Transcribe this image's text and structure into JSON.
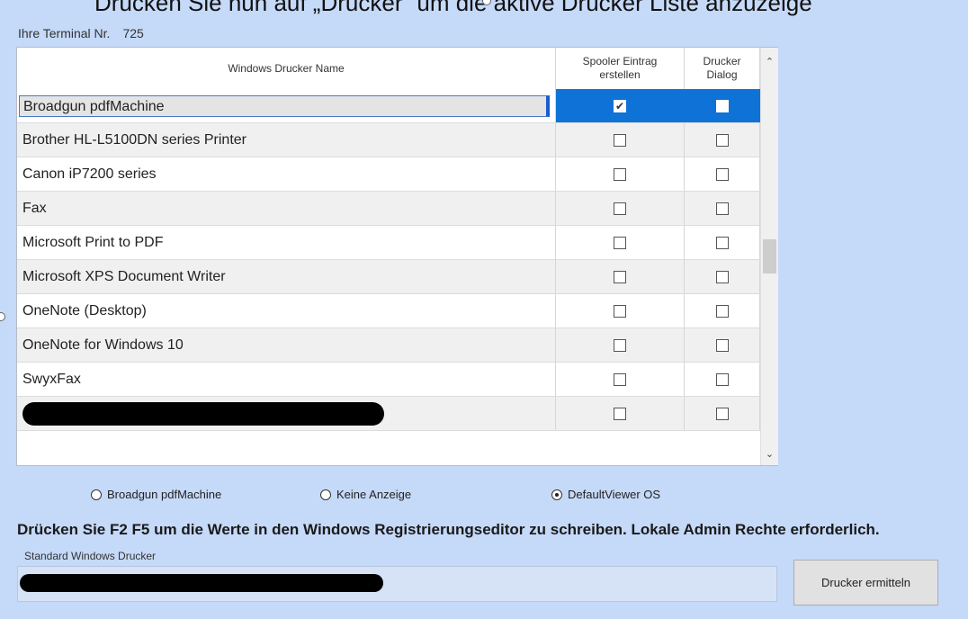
{
  "caption": "Drücken Sie nun auf „Drucker“ um die aktive Drucker Liste anzuzeige",
  "terminal": {
    "label": "Ihre Terminal Nr.",
    "number": "725"
  },
  "grid": {
    "headers": {
      "name": "Windows Drucker Name",
      "spooler": "Spooler Eintrag erstellen",
      "dialog": "Drucker Dialog"
    },
    "rows": [
      {
        "name": "Broadgun pdfMachine",
        "spooler": true,
        "dialog": false,
        "selected": true
      },
      {
        "name": "Brother HL-L5100DN series Printer",
        "spooler": false,
        "dialog": false
      },
      {
        "name": "Canon iP7200 series",
        "spooler": false,
        "dialog": false
      },
      {
        "name": "Fax",
        "spooler": false,
        "dialog": false
      },
      {
        "name": "Microsoft Print to PDF",
        "spooler": false,
        "dialog": false
      },
      {
        "name": "Microsoft XPS Document Writer",
        "spooler": false,
        "dialog": false
      },
      {
        "name": "OneNote (Desktop)",
        "spooler": false,
        "dialog": false
      },
      {
        "name": "OneNote for Windows 10",
        "spooler": false,
        "dialog": false
      },
      {
        "name": "SwyxFax",
        "spooler": false,
        "dialog": false
      },
      {
        "name": "",
        "redacted": true,
        "spooler": false,
        "dialog": false
      }
    ]
  },
  "viewer_options": [
    {
      "label": "Broadgun pdfMachine",
      "selected": false
    },
    {
      "label": "Keine Anzeige",
      "selected": false
    },
    {
      "label": "DefaultViewer OS",
      "selected": true
    }
  ],
  "notice": "Drücken Sie F2 F5 um die Werte in den Windows Registrierungseditor zu schreiben. Lokale Admin Rechte erforderlich.",
  "standard_printer": {
    "label": "Standard Windows Drucker",
    "redacted": true
  },
  "button": {
    "label": "Drucker ermitteln"
  },
  "colors": {
    "background": "#c5d9f8",
    "selection": "#0e72d6"
  }
}
